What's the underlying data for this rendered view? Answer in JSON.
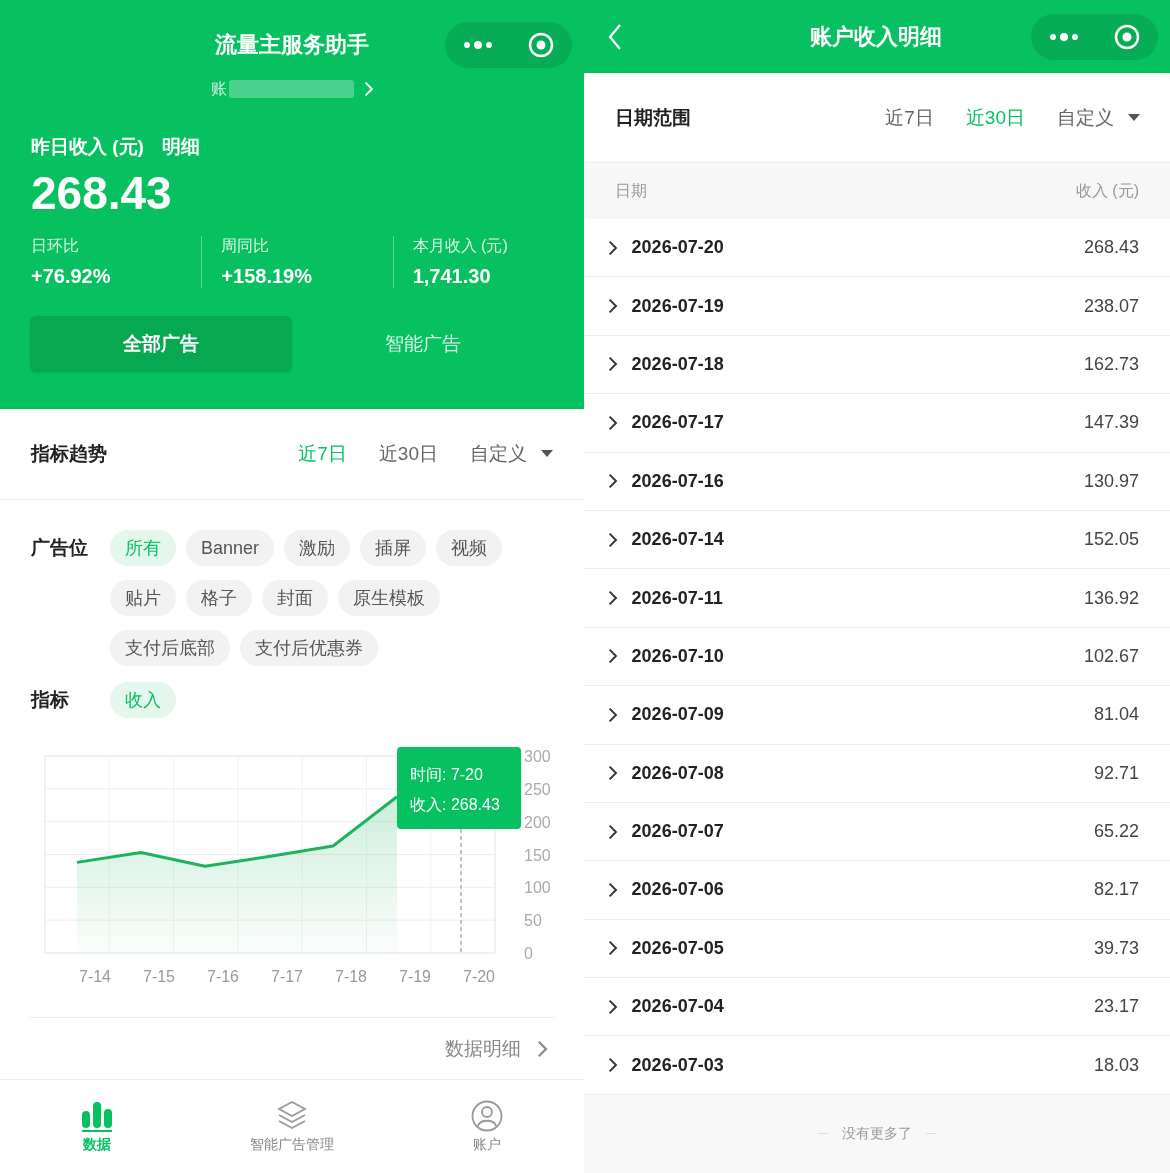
{
  "left": {
    "nav_title": "流量主服务助手",
    "account_prefix": "账",
    "summary_label": "昨日收入 (元)",
    "detail_link": "明细",
    "amount": "268.43",
    "stats": [
      {
        "label": "日环比",
        "value": "+76.92%"
      },
      {
        "label": "周同比",
        "value": "+158.19%"
      },
      {
        "label": "本月收入 (元)",
        "value": "1,741.30"
      }
    ],
    "ad_tabs": [
      {
        "label": "全部广告",
        "selected": true
      },
      {
        "label": "智能广告",
        "selected": false
      }
    ],
    "trend": {
      "title": "指标趋势",
      "ranges": [
        {
          "label": "近7日",
          "selected": true
        },
        {
          "label": "近30日",
          "selected": false
        }
      ],
      "custom": "自定义"
    },
    "ad_slot_label": "广告位",
    "ad_slots": [
      {
        "label": "所有",
        "selected": true
      },
      {
        "label": "Banner",
        "selected": false
      },
      {
        "label": "激励",
        "selected": false
      },
      {
        "label": "插屏",
        "selected": false
      },
      {
        "label": "视频",
        "selected": false
      },
      {
        "label": "贴片",
        "selected": false
      },
      {
        "label": "格子",
        "selected": false
      },
      {
        "label": "封面",
        "selected": false
      },
      {
        "label": "原生模板",
        "selected": false
      },
      {
        "label": "支付后底部",
        "selected": false
      },
      {
        "label": "支付后优惠券",
        "selected": false
      }
    ],
    "metric_label": "指标",
    "metrics": [
      {
        "label": "收入",
        "selected": true
      }
    ],
    "chart": {
      "chart_data": {
        "type": "area",
        "categories": [
          "7-14",
          "7-15",
          "7-16",
          "7-17",
          "7-18",
          "7-19",
          "7-20"
        ],
        "series": [
          {
            "color": "#1db35c",
            "values": [
              138,
              153,
              132,
              147,
              163,
              238,
              null
            ]
          }
        ],
        "ylim": [
          0,
          300
        ],
        "grid": true,
        "yticks": [
          0,
          50,
          100,
          150,
          200,
          250,
          300
        ]
      },
      "tooltip": [
        "时间: 7-20",
        "收入: 268.43"
      ]
    },
    "data_detail_link": "数据明细",
    "tabbar": [
      {
        "label": "数据",
        "kind": "chart",
        "selected": true
      },
      {
        "label": "智能广告管理",
        "kind": "layers",
        "selected": false
      },
      {
        "label": "账户",
        "kind": "person",
        "selected": false
      }
    ]
  },
  "right": {
    "title": "账户收入明细",
    "range_label": "日期范围",
    "ranges": [
      {
        "label": "近7日",
        "selected": false
      },
      {
        "label": "近30日",
        "selected": true
      }
    ],
    "custom": "自定义",
    "columns": [
      "日期",
      "收入 (元)"
    ],
    "rows": [
      {
        "date": "2026-07-20",
        "income": "268.43"
      },
      {
        "date": "2026-07-19",
        "income": "238.07"
      },
      {
        "date": "2026-07-18",
        "income": "162.73"
      },
      {
        "date": "2026-07-17",
        "income": "147.39"
      },
      {
        "date": "2026-07-16",
        "income": "130.97"
      },
      {
        "date": "2026-07-14",
        "income": "152.05"
      },
      {
        "date": "2026-07-11",
        "income": "136.92"
      },
      {
        "date": "2026-07-10",
        "income": "102.67"
      },
      {
        "date": "2026-07-09",
        "income": "81.04"
      },
      {
        "date": "2026-07-08",
        "income": "92.71"
      },
      {
        "date": "2026-07-07",
        "income": "65.22"
      },
      {
        "date": "2026-07-06",
        "income": "82.17"
      },
      {
        "date": "2026-07-05",
        "income": "39.73"
      },
      {
        "date": "2026-07-04",
        "income": "23.17"
      },
      {
        "date": "2026-07-03",
        "income": "18.03"
      }
    ],
    "footer": "没有更多了"
  }
}
